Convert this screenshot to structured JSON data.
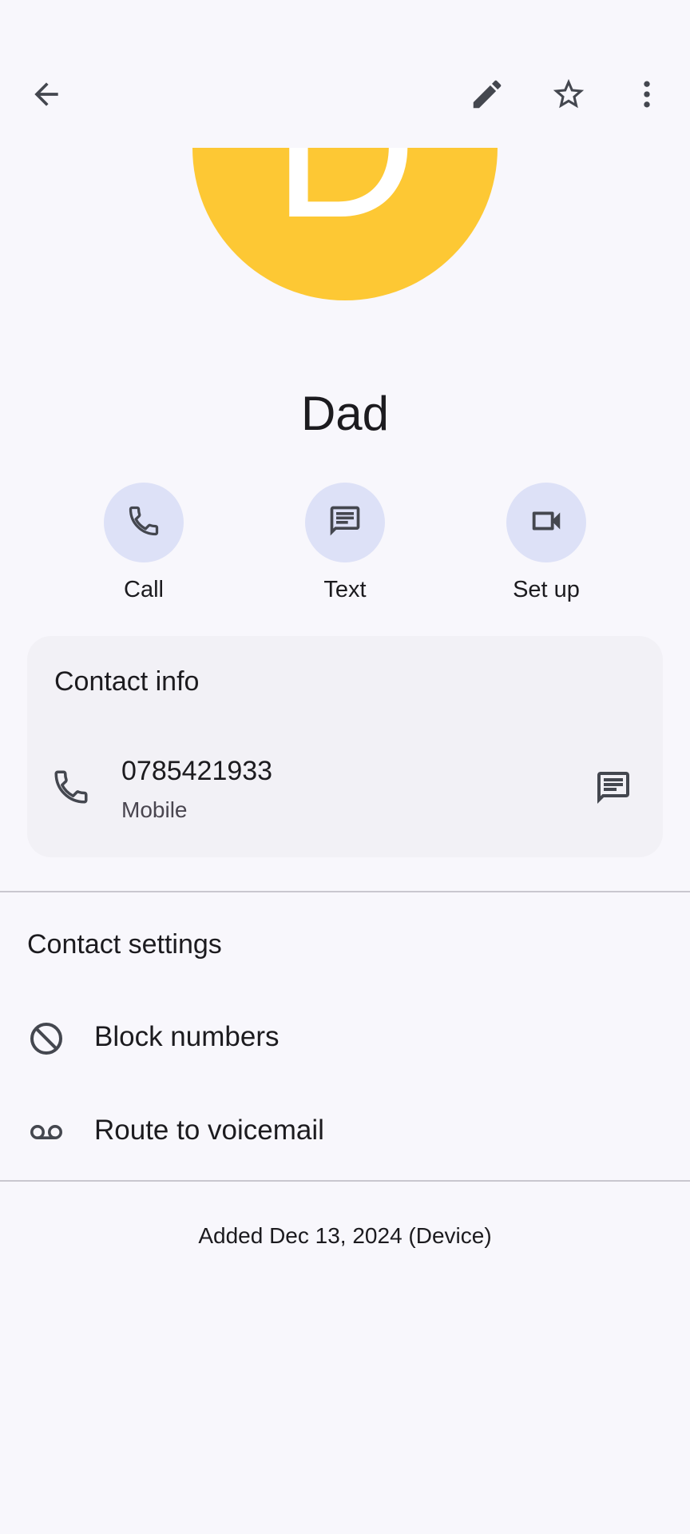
{
  "top_bar": {
    "back_icon": "arrow-back-icon",
    "edit_icon": "pencil-icon",
    "favorite_icon": "star-outline-icon",
    "more_icon": "more-vert-icon"
  },
  "contact": {
    "initial": "D",
    "name": "Dad",
    "avatar_color": "#fdc834"
  },
  "actions": [
    {
      "label": "Call",
      "icon": "phone-icon"
    },
    {
      "label": "Text",
      "icon": "message-icon"
    },
    {
      "label": "Set up",
      "icon": "video-camera-icon"
    }
  ],
  "contact_info": {
    "title": "Contact info",
    "phone": {
      "number": "0785421933",
      "type": "Mobile",
      "icon": "phone-icon",
      "message_icon": "message-icon"
    }
  },
  "contact_settings": {
    "title": "Contact settings",
    "items": [
      {
        "label": "Block numbers",
        "icon": "block-icon"
      },
      {
        "label": "Route to voicemail",
        "icon": "voicemail-icon"
      }
    ]
  },
  "footer": {
    "added_text": "Added Dec 13, 2024 (Device)"
  },
  "colors": {
    "background": "#f8f7fc",
    "action_circle": "#dde1f7",
    "card": "#f2f1f6",
    "icon": "#44474f"
  }
}
